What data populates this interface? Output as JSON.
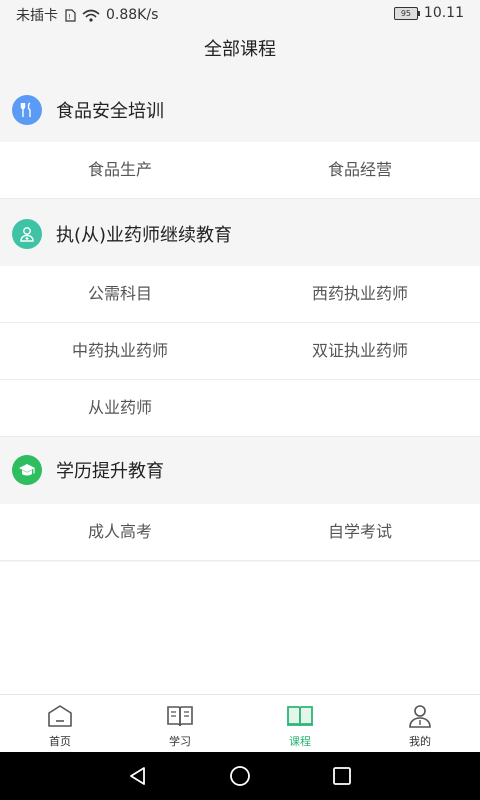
{
  "status_bar": {
    "left_text": "未插卡",
    "speed": "0.88K/s",
    "battery": "95",
    "time": "10.11"
  },
  "header": {
    "title": "全部课程"
  },
  "sections": [
    {
      "title": "食品安全培训",
      "icon": "fork-knife-icon",
      "icon_color": "#5b9bf5",
      "items": [
        "食品生产",
        "食品经营"
      ]
    },
    {
      "title": "执(从)业药师继续教育",
      "icon": "pharmacist-icon",
      "icon_color": "#3fc3a6",
      "items": [
        "公需科目",
        "西药执业药师",
        "中药执业药师",
        "双证执业药师",
        "从业药师"
      ]
    },
    {
      "title": "学历提升教育",
      "icon": "graduation-cap-icon",
      "icon_color": "#2ebd5f",
      "items": [
        "成人高考",
        "自学考试"
      ]
    }
  ],
  "bottom_nav": {
    "items": [
      {
        "label": "首页",
        "icon": "home-icon"
      },
      {
        "label": "学习",
        "icon": "open-book-icon"
      },
      {
        "label": "课程",
        "icon": "course-book-icon",
        "active": true
      },
      {
        "label": "我的",
        "icon": "profile-icon"
      }
    ],
    "active_color": "#2bb673"
  },
  "system_nav": [
    "back-icon",
    "home-circle-icon",
    "recents-icon"
  ]
}
